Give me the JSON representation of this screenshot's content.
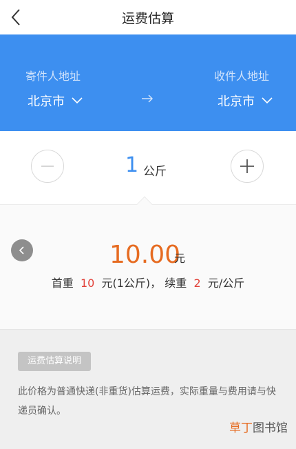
{
  "nav": {
    "title": "运费估算",
    "back_icon": "chevron-left-icon"
  },
  "address": {
    "sender_label": "寄件人地址",
    "sender_city": "北京市",
    "receiver_label": "收件人地址",
    "receiver_city": "北京市",
    "arrow": "→",
    "band_color": "#3d8ff0"
  },
  "weight": {
    "value": "1",
    "unit": "公斤",
    "accent": "#3d8ff0"
  },
  "result": {
    "price": "10.00",
    "price_unit": "元",
    "first_label": "首重",
    "first_value": "10",
    "first_unit": "元(1公斤)，",
    "continue_label": "续重",
    "continue_value": "2",
    "continue_unit": "元/公斤",
    "price_color": "#e66b21",
    "highlight_color": "#e2423a"
  },
  "note": {
    "tag": "运费估算说明",
    "text": "此价格为普通快递(非重货)估算运费，实际重量与费用请与快递员确认。"
  },
  "watermark": {
    "part1": "草丁",
    "part2": "图书馆"
  }
}
